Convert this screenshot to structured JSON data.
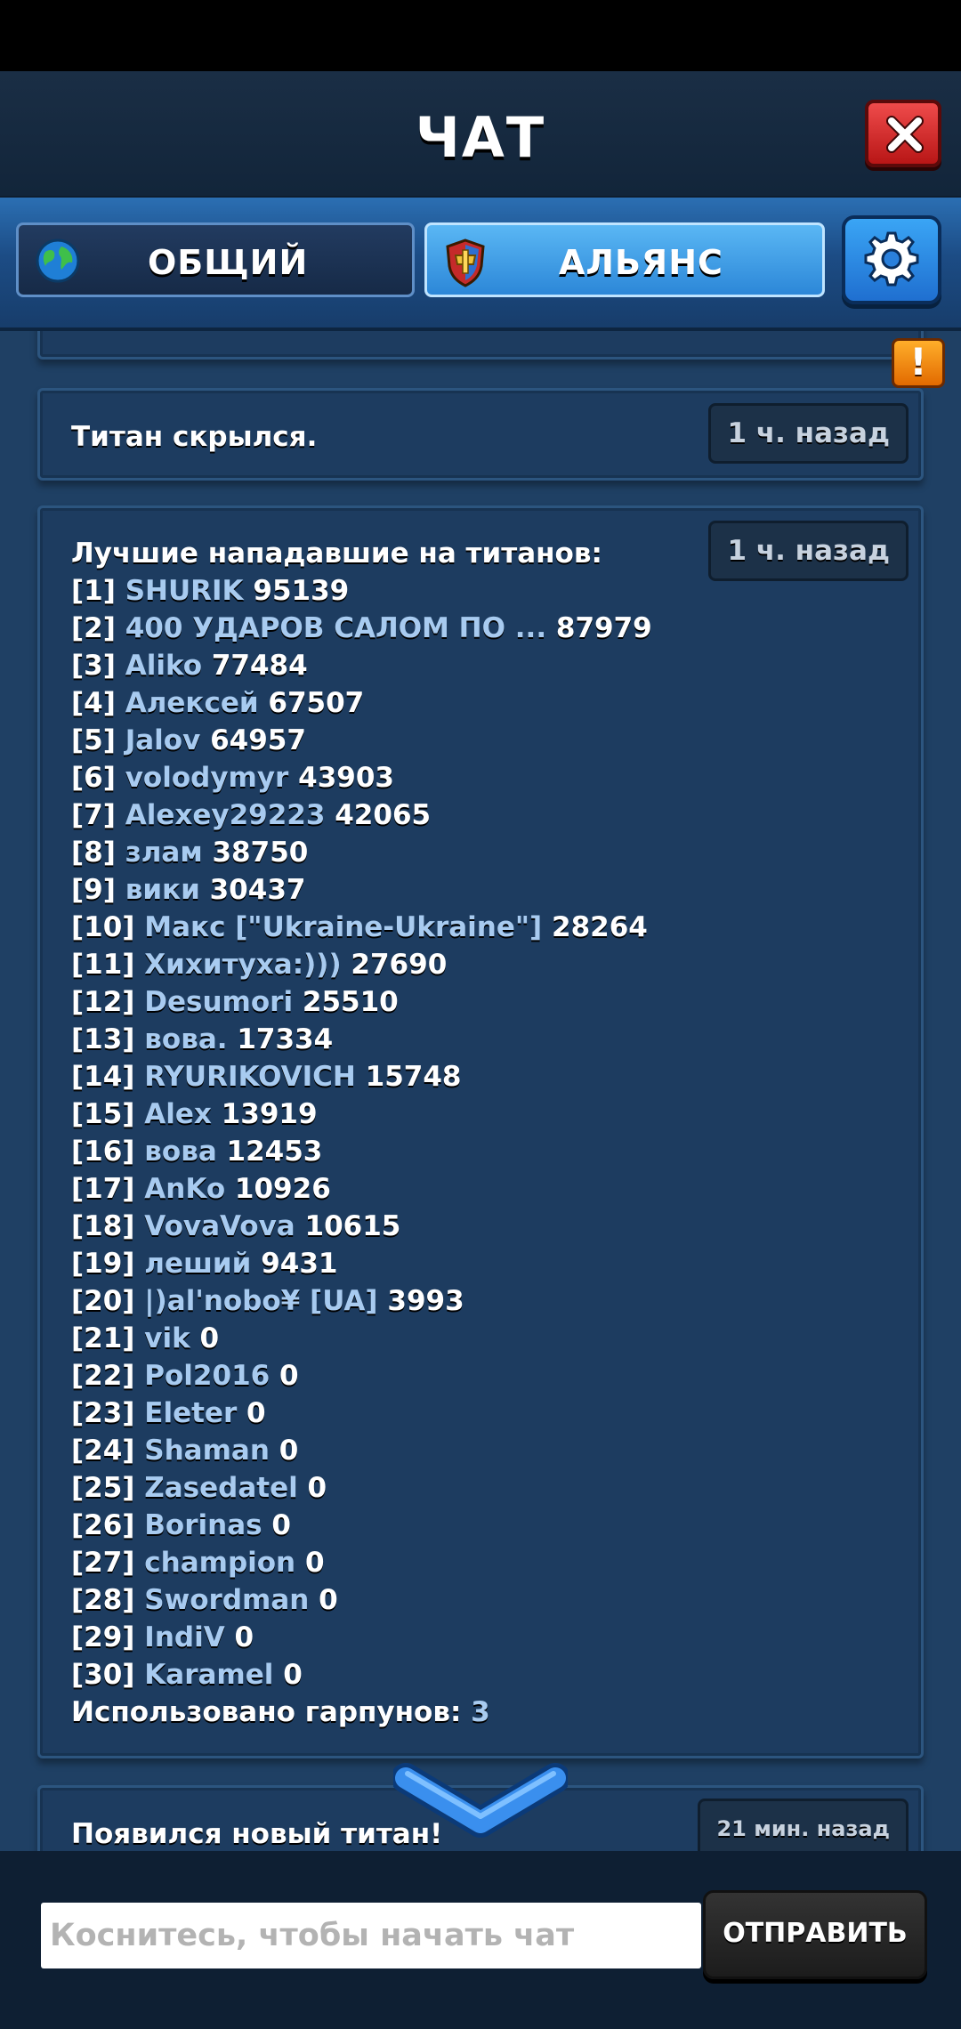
{
  "header": {
    "title": "ЧАТ"
  },
  "tabs": {
    "general": "ОБЩИЙ",
    "alliance": "АЛЬЯНС",
    "selected": "alliance"
  },
  "messages": {
    "titan_hidden": {
      "text": "Титан скрылся.",
      "time": "1 ч. назад"
    },
    "leaderboard": {
      "time": "1 ч. назад",
      "heading": "Лучшие нападавшие на титанов:",
      "entries": [
        {
          "rank": "[1]",
          "name": "SHURIK",
          "score": "95139"
        },
        {
          "rank": "[2]",
          "name": "400 УДАРОВ САЛОМ ПО ...",
          "score": "87979"
        },
        {
          "rank": "[3]",
          "name": "Aliko",
          "score": "77484"
        },
        {
          "rank": "[4]",
          "name": "Алексей",
          "score": "67507"
        },
        {
          "rank": "[5]",
          "name": "Jalov",
          "score": "64957"
        },
        {
          "rank": "[6]",
          "name": "volodymyr",
          "score": "43903"
        },
        {
          "rank": "[7]",
          "name": "Alexey29223",
          "score": "42065"
        },
        {
          "rank": "[8]",
          "name": "злам",
          "score": "38750"
        },
        {
          "rank": "[9]",
          "name": "вики",
          "score": "30437"
        },
        {
          "rank": "[10]",
          "name": "Макс [\"Ukraine-Ukraine\"]",
          "score": "28264"
        },
        {
          "rank": "[11]",
          "name": "Хихитуха:)))",
          "score": "27690"
        },
        {
          "rank": "[12]",
          "name": "Desumori",
          "score": "25510"
        },
        {
          "rank": "[13]",
          "name": "вова.",
          "score": "17334"
        },
        {
          "rank": "[14]",
          "name": "RYURIKOVICH",
          "score": "15748"
        },
        {
          "rank": "[15]",
          "name": "Alex",
          "score": "13919"
        },
        {
          "rank": "[16]",
          "name": "вова",
          "score": "12453"
        },
        {
          "rank": "[17]",
          "name": "AnKo",
          "score": "10926"
        },
        {
          "rank": "[18]",
          "name": "VovaVova",
          "score": "10615"
        },
        {
          "rank": "[19]",
          "name": "леший",
          "score": "9431"
        },
        {
          "rank": "[20]",
          "name": "|)al'nobo¥ [UA]",
          "score": "3993"
        },
        {
          "rank": "[21]",
          "name": "vik",
          "score": "0"
        },
        {
          "rank": "[22]",
          "name": "Pol2016",
          "score": "0"
        },
        {
          "rank": "[23]",
          "name": "Eleter",
          "score": "0"
        },
        {
          "rank": "[24]",
          "name": "Shaman",
          "score": "0"
        },
        {
          "rank": "[25]",
          "name": "Zasedatel",
          "score": "0"
        },
        {
          "rank": "[26]",
          "name": "Borinas",
          "score": "0"
        },
        {
          "rank": "[27]",
          "name": "champion",
          "score": "0"
        },
        {
          "rank": "[28]",
          "name": "Swordman",
          "score": "0"
        },
        {
          "rank": "[29]",
          "name": "IndiV",
          "score": "0"
        },
        {
          "rank": "[30]",
          "name": "Karamel",
          "score": "0"
        }
      ],
      "harpoons_label": "Использовано гарпунов:",
      "harpoons_value": "3"
    },
    "new_titan": {
      "text": "Появился новый титан!",
      "time": "21 мин. назад"
    }
  },
  "input": {
    "placeholder": "Коснитесь, чтобы начать чат",
    "value": ""
  },
  "send_button": "ОТПРАВИТЬ",
  "icons": {
    "close": "close-icon",
    "globe": "globe-icon",
    "shield": "alliance-shield-icon",
    "settings": "gear-icon",
    "alert": "alert-icon",
    "scroll": "chevron-down-icon"
  },
  "colors": {
    "accent": "#4aa3ef",
    "name": "#a8cbf0",
    "close": "#d62828",
    "alert": "#f28a00"
  }
}
